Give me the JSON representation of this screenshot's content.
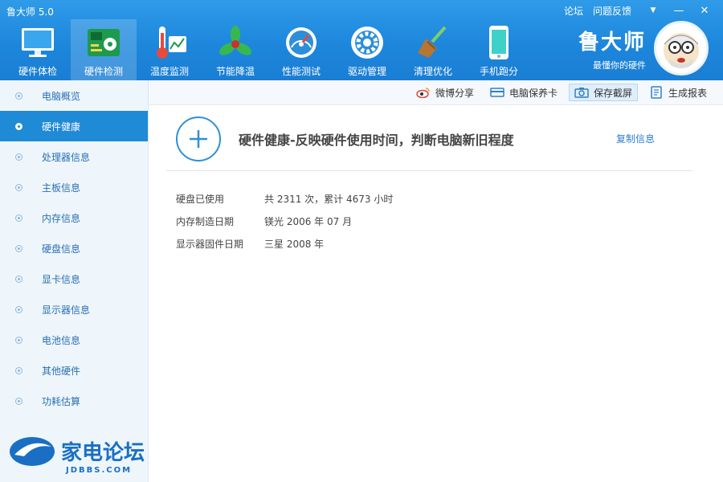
{
  "app": {
    "title": "鲁大师 5.0"
  },
  "top_links": {
    "forum": "论坛",
    "feedback": "问题反馈"
  },
  "window_controls": {
    "menu_glyph": "▼",
    "minimize_glyph": "—",
    "close_glyph": "✕"
  },
  "toolbar": [
    {
      "label": "硬件体检",
      "icon": "monitor-icon",
      "active": false
    },
    {
      "label": "硬件检测",
      "icon": "circuit-board-icon",
      "active": true
    },
    {
      "label": "温度监测",
      "icon": "thermometer-icon",
      "active": false
    },
    {
      "label": "节能降温",
      "icon": "fan-icon",
      "active": false
    },
    {
      "label": "性能测试",
      "icon": "speedometer-icon",
      "active": false
    },
    {
      "label": "驱动管理",
      "icon": "gear-icon",
      "active": false
    },
    {
      "label": "清理优化",
      "icon": "broom-icon",
      "active": false
    },
    {
      "label": "手机跑分",
      "icon": "phone-icon",
      "active": false
    }
  ],
  "brand": {
    "name": "鲁大师",
    "slogan": "最懂你的硬件"
  },
  "sidebar": {
    "items": [
      {
        "label": "电脑概览",
        "active": false
      },
      {
        "label": "硬件健康",
        "active": true
      },
      {
        "label": "处理器信息",
        "active": false
      },
      {
        "label": "主板信息",
        "active": false
      },
      {
        "label": "内存信息",
        "active": false
      },
      {
        "label": "硬盘信息",
        "active": false
      },
      {
        "label": "显卡信息",
        "active": false
      },
      {
        "label": "显示器信息",
        "active": false
      },
      {
        "label": "电池信息",
        "active": false
      },
      {
        "label": "其他硬件",
        "active": false
      },
      {
        "label": "功耗估算",
        "active": false
      }
    ]
  },
  "watermark": {
    "text": "家电论坛",
    "subtext": "JDBBS.COM"
  },
  "actions": {
    "weibo_share": "微博分享",
    "warranty_card": "电脑保养卡",
    "save_screenshot": "保存截屏",
    "generate_report": "生成报表"
  },
  "main": {
    "title": "硬件健康-反映硬件使用时间，判断电脑新旧程度",
    "copy_info": "复制信息",
    "rows": [
      {
        "label": "硬盘已使用",
        "value": "共 2311 次，累计 4673 小时"
      },
      {
        "label": "内存制造日期",
        "value": "镁光 2006 年 07 月"
      },
      {
        "label": "显示器固件日期",
        "value": "三星 2008 年"
      }
    ]
  },
  "colors": {
    "header": "#1d87dc",
    "accent": "#1f8ad6",
    "sidebar_bg": "#eef6fc",
    "link": "#2f7fcc"
  }
}
